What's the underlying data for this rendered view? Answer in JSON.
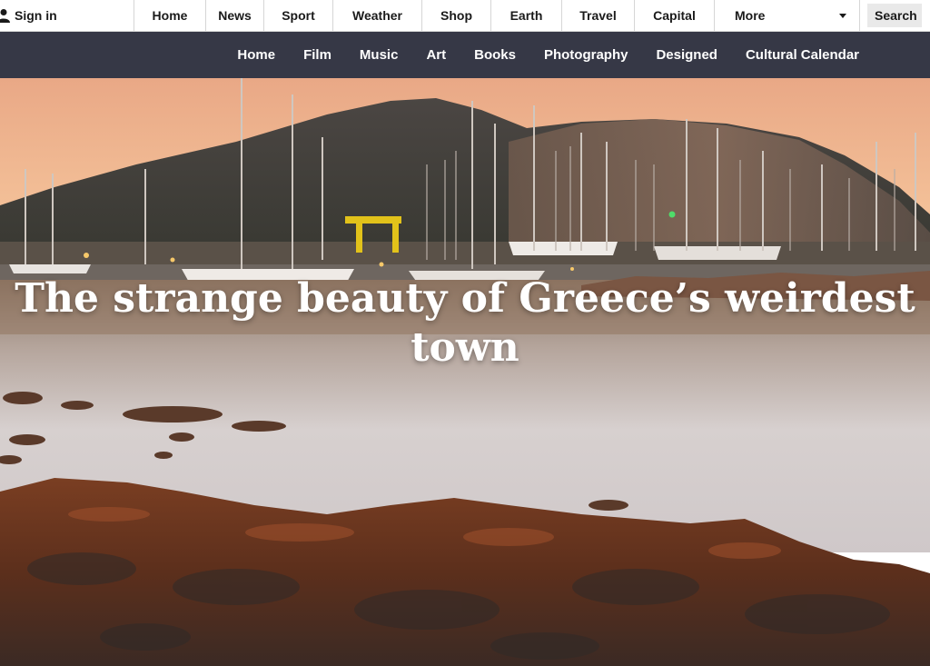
{
  "header": {
    "signin_label": "Sign in",
    "nav": [
      {
        "label": "Home",
        "id": "home"
      },
      {
        "label": "News",
        "id": "news"
      },
      {
        "label": "Sport",
        "id": "sport"
      },
      {
        "label": "Weather",
        "id": "weather"
      },
      {
        "label": "Shop",
        "id": "shop"
      },
      {
        "label": "Earth",
        "id": "earth"
      },
      {
        "label": "Travel",
        "id": "travel"
      },
      {
        "label": "Capital",
        "id": "capital"
      }
    ],
    "more_label": "More",
    "search_label": "Search"
  },
  "subnav": {
    "items": [
      {
        "label": "Home",
        "id": "home"
      },
      {
        "label": "Film",
        "id": "film"
      },
      {
        "label": "Music",
        "id": "music"
      },
      {
        "label": "Art",
        "id": "art"
      },
      {
        "label": "Books",
        "id": "books"
      },
      {
        "label": "Photography",
        "id": "photography"
      },
      {
        "label": "Designed",
        "id": "designed"
      },
      {
        "label": "Cultural Calendar",
        "id": "cultural-calendar"
      }
    ]
  },
  "hero": {
    "headline": "The strange beauty of Greece’s weirdest town"
  },
  "colors": {
    "subnav_bg": "#363846",
    "topbar_bg": "#ffffff",
    "text_dark": "#1a1a1a"
  }
}
